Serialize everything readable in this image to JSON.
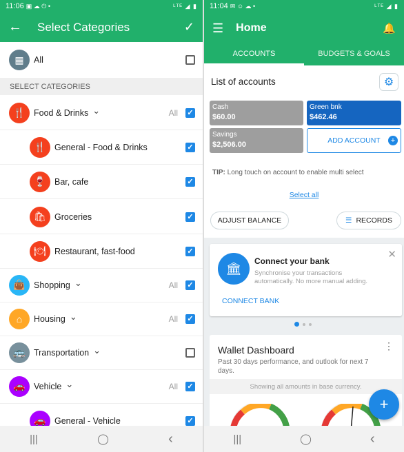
{
  "left": {
    "status": {
      "time": "11:06",
      "icons": "▣ ☁ ⏻ •",
      "right": "ᴸᵀᴱ ◢ ▮"
    },
    "title": "Select Categories",
    "all_label": "All",
    "section_header": "SELECT CATEGORIES",
    "all_small": "All",
    "rows": [
      {
        "label": "Food & Drinks",
        "icon": "fork-knife-icon",
        "glyph": "🍴",
        "color": "#f4401e",
        "checked": true,
        "top_level": true,
        "show_all": true
      },
      {
        "label": "General - Food & Drinks",
        "icon": "fork-knife-icon",
        "glyph": "🍴",
        "color": "#f4401e",
        "checked": true,
        "top_level": false
      },
      {
        "label": "Bar, cafe",
        "icon": "wine-glass-icon",
        "glyph": "🍷",
        "color": "#f4401e",
        "checked": true,
        "top_level": false
      },
      {
        "label": "Groceries",
        "icon": "grocery-bag-icon",
        "glyph": "🛍",
        "color": "#f4401e",
        "checked": true,
        "top_level": false
      },
      {
        "label": "Restaurant, fast-food",
        "icon": "cloche-icon",
        "glyph": "🍽",
        "color": "#f4401e",
        "checked": true,
        "top_level": false
      },
      {
        "label": "Shopping",
        "icon": "shopping-bag-icon",
        "glyph": "👜",
        "color": "#29b6f6",
        "checked": true,
        "top_level": true,
        "show_all": true
      },
      {
        "label": "Housing",
        "icon": "house-icon",
        "glyph": "⌂",
        "color": "#ffa726",
        "checked": true,
        "top_level": true,
        "show_all": true
      },
      {
        "label": "Transportation",
        "icon": "bus-icon",
        "glyph": "🚌",
        "color": "#78909c",
        "checked": false,
        "top_level": true,
        "show_all": false
      },
      {
        "label": "Vehicle",
        "icon": "car-icon",
        "glyph": "🚗",
        "color": "#aa00ff",
        "checked": true,
        "top_level": true,
        "show_all": true
      },
      {
        "label": "General - Vehicle",
        "icon": "car-icon",
        "glyph": "🚗",
        "color": "#aa00ff",
        "checked": true,
        "top_level": false
      }
    ]
  },
  "right": {
    "status": {
      "time": "11:04",
      "icons": "✉ ☺ ☁ •",
      "right": "ᴸᵀᴱ ◢ ▮"
    },
    "title": "Home",
    "tabs": [
      "ACCOUNTS",
      "BUDGETS & GOALS"
    ],
    "list_title": "List of accounts",
    "accounts": [
      {
        "name": "Cash",
        "value": "$60.00",
        "color": "#9e9e9e"
      },
      {
        "name": "Green bnk",
        "value": "$462.46",
        "color": "#1565c0"
      },
      {
        "name": "Savings",
        "value": "$2,506.00",
        "color": "#9e9e9e"
      }
    ],
    "add_account": "ADD ACCOUNT",
    "tip_prefix": "TIP:",
    "tip": "Long touch on account to enable multi select",
    "select_all": "Select all",
    "adjust_balance": "ADJUST BALANCE",
    "records": "RECORDS",
    "bank": {
      "title": "Connect your bank",
      "desc": "Synchronise your transactions automatically. No more manual adding.",
      "action": "CONNECT BANK"
    },
    "dashboard": {
      "title": "Wallet Dashboard",
      "desc": "Past 30 days performance, and outlook for next 7 days.",
      "note": "Showing all amounts in base currency."
    },
    "fab": "+"
  },
  "nav": {
    "recent": "|||",
    "home": "◯",
    "back": "‹"
  }
}
